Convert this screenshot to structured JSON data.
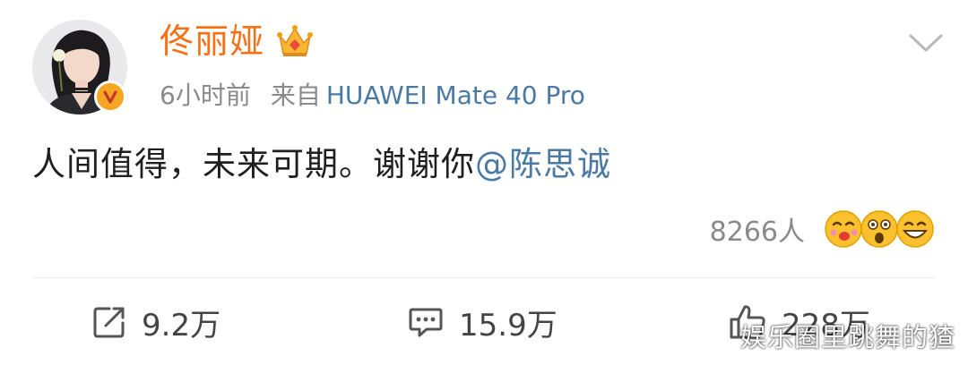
{
  "post": {
    "author_name": "佟丽娅",
    "time_ago": "6小时前",
    "source_label": "来自",
    "device": "HUAWEI Mate 40 Pro",
    "text_body": "人间值得，未来可期。谢谢你",
    "mention": "@陈思诚",
    "reactions": {
      "count": "8266人",
      "emoji_icons": [
        "kiss-face-icon",
        "shocked-face-icon",
        "grinning-face-icon"
      ]
    }
  },
  "actions": {
    "share_count": "9.2万",
    "comment_count": "15.9万",
    "like_count": "228万"
  },
  "watermark": "娱乐圈里跳舞的猹",
  "colors": {
    "author_name": "#f86f14",
    "link": "#4a79a6",
    "muted_text": "#8a8a8a",
    "body_text": "#1f1f1f",
    "verified_badge": "#f5a623"
  }
}
